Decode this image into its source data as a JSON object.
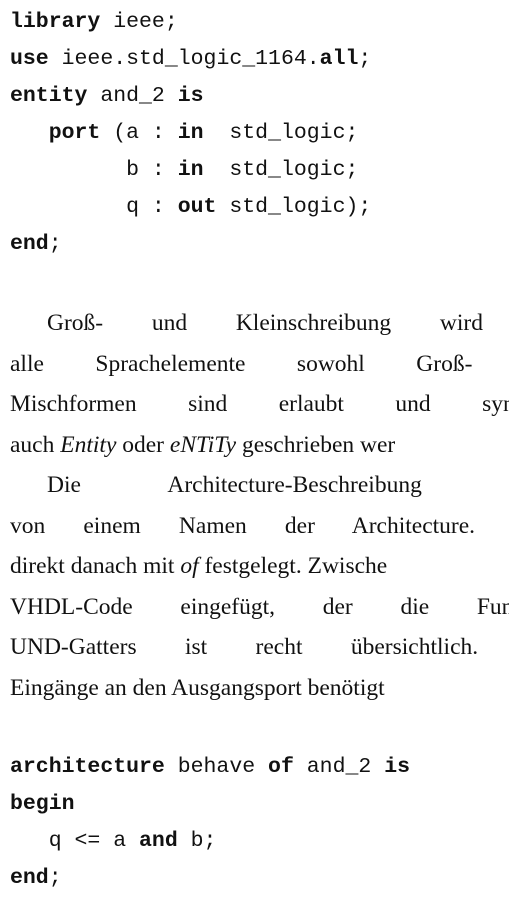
{
  "code_block_1": [
    [
      {
        "t": "library",
        "b": true
      },
      {
        "t": " ieee;",
        "b": false
      }
    ],
    [
      {
        "t": "use",
        "b": true
      },
      {
        "t": " ieee.std_logic_1164.",
        "b": false
      },
      {
        "t": "all",
        "b": true
      },
      {
        "t": ";",
        "b": false
      }
    ],
    [
      {
        "t": "entity",
        "b": true
      },
      {
        "t": " and_2 ",
        "b": false
      },
      {
        "t": "is",
        "b": true
      }
    ],
    [
      {
        "t": "   ",
        "b": false
      },
      {
        "t": "port",
        "b": true
      },
      {
        "t": " (a : ",
        "b": false
      },
      {
        "t": "in",
        "b": true
      },
      {
        "t": "  std_logic;",
        "b": false
      }
    ],
    [
      {
        "t": "         b : ",
        "b": false
      },
      {
        "t": "in",
        "b": true
      },
      {
        "t": "  std_logic;",
        "b": false
      }
    ],
    [
      {
        "t": "         q : ",
        "b": false
      },
      {
        "t": "out",
        "b": true
      },
      {
        "t": " std_logic);",
        "b": false
      }
    ],
    [
      {
        "t": "end",
        "b": true
      },
      {
        "t": ";",
        "b": false
      }
    ]
  ],
  "paragraph_1": {
    "line_1": "Groß- und Kleinschreibung wird in",
    "line_2": "alle Sprachelemente sowohl Groß- als",
    "line_3": "Mischformen sind erlaubt und syntakt",
    "line_4_pre": "auch ",
    "line_4_it1": "Entity",
    "line_4_mid": " oder ",
    "line_4_it2": "eNTiTy",
    "line_4_post": " geschrieben wer"
  },
  "paragraph_2": {
    "line_1": "Die Architecture-Beschreibung start",
    "line_2": "von einem Namen der Architecture. Wel",
    "line_3_pre": "direkt danach mit ",
    "line_3_it": "of",
    "line_3_post": " festgelegt. Zwische",
    "line_4": "VHDL-Code eingefügt, der die Funktio",
    "line_5": "UND-Gatters ist recht übersichtlich. Di",
    "line_6": "Eingänge an den Ausgangsport benötigt"
  },
  "code_block_2": [
    [
      {
        "t": "architecture",
        "b": true
      },
      {
        "t": " behave ",
        "b": false
      },
      {
        "t": "of",
        "b": true
      },
      {
        "t": " and_2 ",
        "b": false
      },
      {
        "t": "is",
        "b": true
      }
    ],
    [
      {
        "t": "begin",
        "b": true
      }
    ],
    [
      {
        "t": "   q <= a ",
        "b": false
      },
      {
        "t": "and",
        "b": true
      },
      {
        "t": " b;",
        "b": false
      }
    ],
    [
      {
        "t": "end",
        "b": true
      },
      {
        "t": ";",
        "b": false
      }
    ]
  ]
}
